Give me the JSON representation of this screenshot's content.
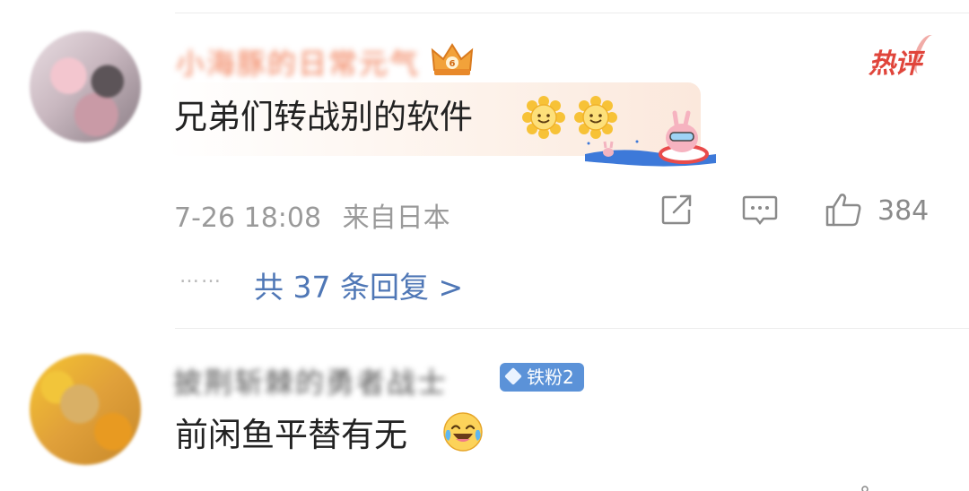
{
  "comments": [
    {
      "username": "小海豚的日常元气",
      "hot_label": "热评",
      "text": "兄弟们转战别的软件",
      "time": "7-26 18:08",
      "location": "来自日本",
      "like_count": "384",
      "replies_link": "共 37 条回复 >",
      "replies_dots": "……"
    },
    {
      "username": "披荆斩棘的勇者战士",
      "fan_badge": "铁粉2",
      "text": "前闲鱼平替有无"
    }
  ],
  "icons": {
    "crown": "crown-level-badge-icon",
    "sun": "sun-smile-emoji-icon",
    "swim": "bunny-swim-ring-sticker-icon",
    "share": "share-icon",
    "comment": "comment-icon",
    "like": "thumbs-up-icon",
    "laugh": "laughing-crying-emoji-icon",
    "fan": "diamond-icon"
  },
  "colors": {
    "link": "#4f77b6",
    "hot": "#e0453b",
    "fan_badge": "#5b92d8",
    "meta": "#9a9a9a"
  }
}
